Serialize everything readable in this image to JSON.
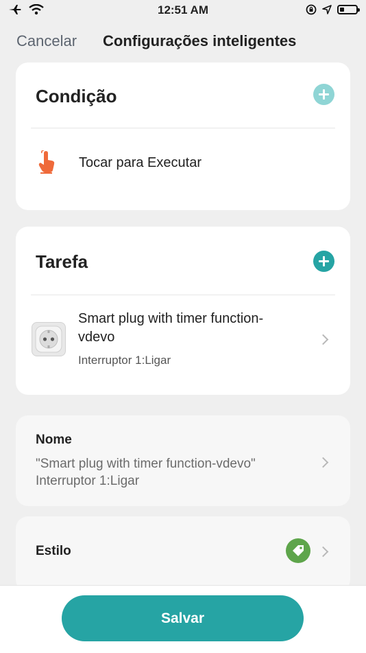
{
  "status_bar": {
    "time": "12:51 AM",
    "battery_level": 0.25
  },
  "header": {
    "cancel_label": "Cancelar",
    "title": "Configurações inteligentes"
  },
  "condition": {
    "heading": "Condição",
    "item_label": "Tocar para Executar"
  },
  "task": {
    "heading": "Tarefa",
    "device_name": "Smart plug with timer function-vdevo",
    "device_action": "Interruptor 1:Ligar"
  },
  "name_section": {
    "label": "Nome",
    "value": "\"Smart plug with timer function-vdevo\" Interruptor 1:Ligar"
  },
  "style_section": {
    "label": "Estilo",
    "tag_color": "#5ea54b"
  },
  "footer": {
    "save_label": "Salvar"
  },
  "colors": {
    "accent": "#26a4a4",
    "accent_light": "#8fd5d5",
    "hand_icon": "#ef6a3a",
    "background": "#efefef"
  }
}
